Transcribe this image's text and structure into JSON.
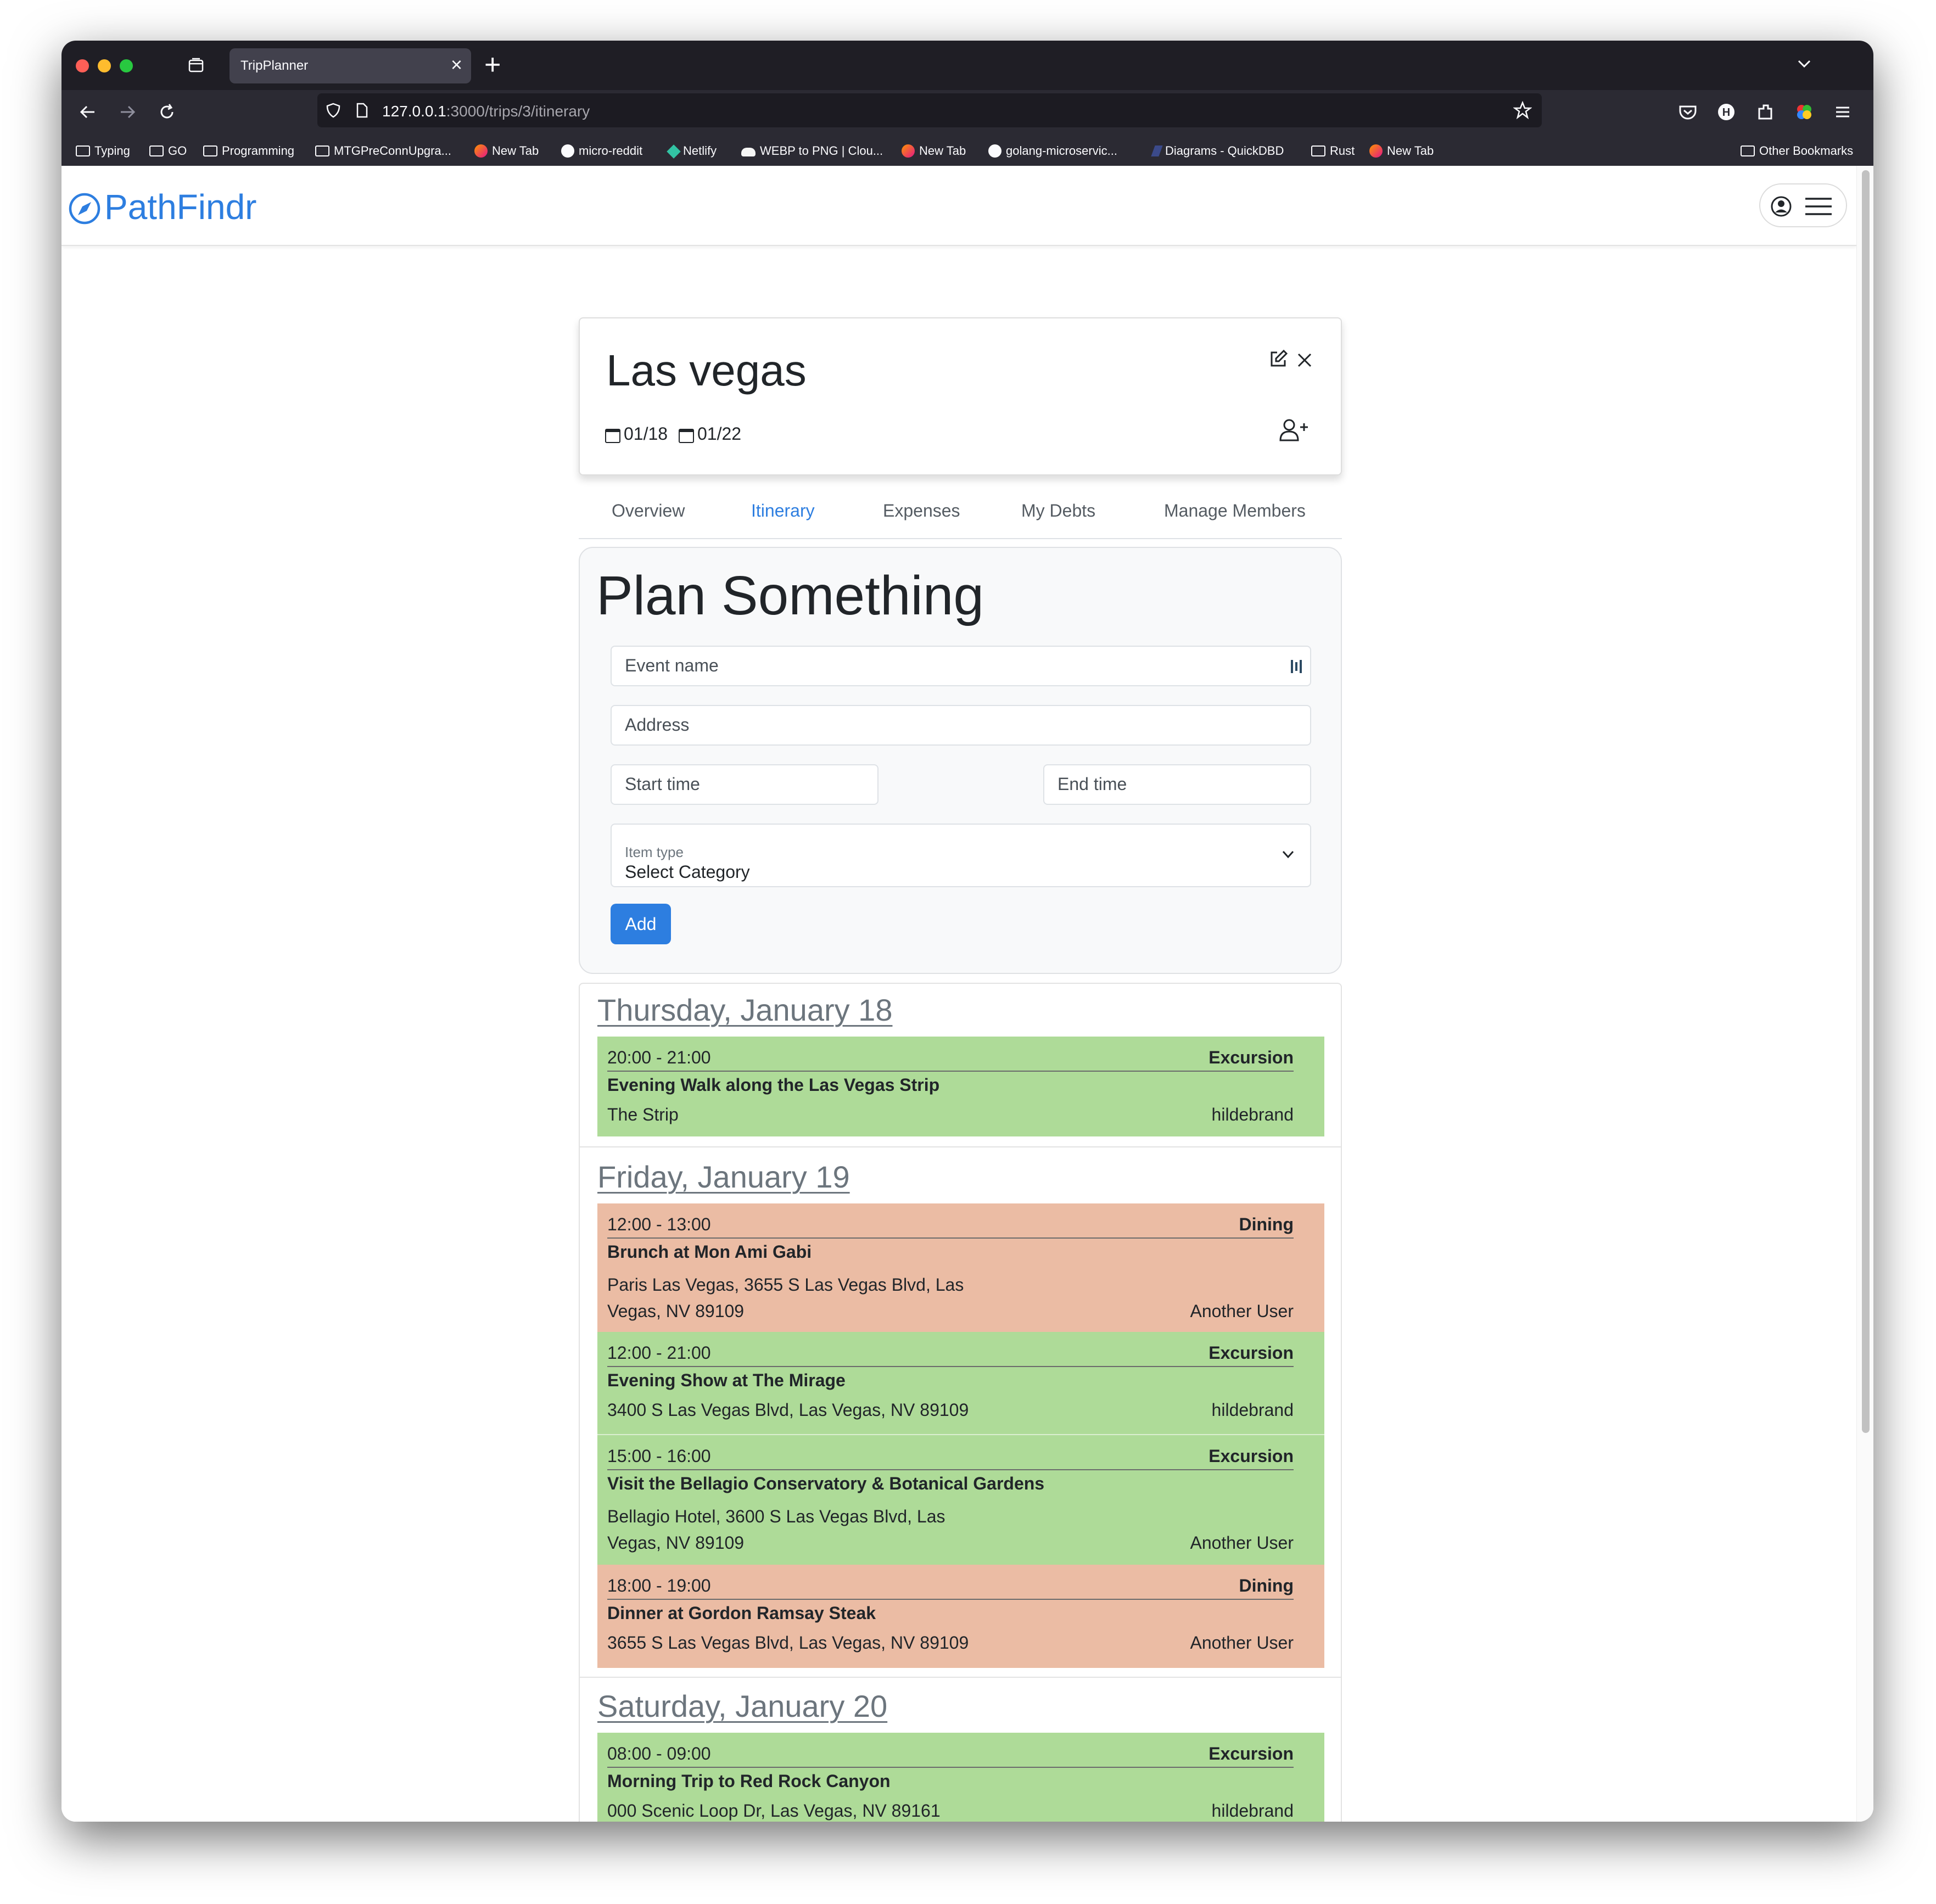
{
  "browser": {
    "tab_title": "TripPlanner",
    "url_host": "127.0.0.1",
    "url_path": ":3000/trips/3/itinerary",
    "bookmarks": [
      {
        "label": "Typing",
        "icon": "folder-icon"
      },
      {
        "label": "GO",
        "icon": "folder-icon"
      },
      {
        "label": "Programming",
        "icon": "folder-icon"
      },
      {
        "label": "MTGPreConnUpgra...",
        "icon": "folder-icon"
      },
      {
        "label": "New Tab",
        "icon": "firefox-icon"
      },
      {
        "label": "micro-reddit",
        "icon": "github-icon"
      },
      {
        "label": "Netlify",
        "icon": "netlify-icon"
      },
      {
        "label": "WEBP to PNG | Clou...",
        "icon": "cloud-icon"
      },
      {
        "label": "New Tab",
        "icon": "firefox-icon"
      },
      {
        "label": "golang-microservic...",
        "icon": "github-icon"
      },
      {
        "label": "Diagrams - QuickDBD",
        "icon": "quickdbd-icon"
      },
      {
        "label": "Rust",
        "icon": "folder-icon"
      },
      {
        "label": "New Tab",
        "icon": "firefox-icon"
      }
    ],
    "other_bookmarks": "Other Bookmarks"
  },
  "app": {
    "brand": "PathFindr",
    "accent": "#2d7ee0"
  },
  "trip": {
    "title": "Las vegas",
    "start": "01/18",
    "end": "01/22"
  },
  "tabs": [
    "Overview",
    "Itinerary",
    "Expenses",
    "My Debts",
    "Manage Members"
  ],
  "active_tab": "Itinerary",
  "plan": {
    "heading": "Plan Something",
    "event_name_placeholder": "Event name",
    "address_placeholder": "Address",
    "start_placeholder": "Start time",
    "end_placeholder": "End time",
    "item_type_label": "Item type",
    "item_type_value": "Select Category",
    "add_label": "Add"
  },
  "days": [
    {
      "heading": "Thursday, January 18",
      "events": [
        {
          "time": "20:00 - 21:00",
          "type": "Excursion",
          "name": "Evening Walk along the Las Vegas Strip",
          "address": "The Strip",
          "user": "hildebrand",
          "color": "#aedb98"
        }
      ]
    },
    {
      "heading": "Friday, January 19",
      "events": [
        {
          "time": "12:00 - 13:00",
          "type": "Dining",
          "name": "Brunch at Mon Ami Gabi",
          "address_line1": "Paris Las Vegas, 3655 S Las Vegas Blvd, Las",
          "address_line2": "Vegas, NV 89109",
          "user": "Another User",
          "color": "#ebbca4"
        },
        {
          "time": "12:00 - 21:00",
          "type": "Excursion",
          "name": "Evening Show at The Mirage",
          "address": "3400 S Las Vegas Blvd, Las Vegas, NV 89109",
          "user": "hildebrand",
          "color": "#aedb98"
        },
        {
          "time": "15:00 - 16:00",
          "type": "Excursion",
          "name": "Visit the Bellagio Conservatory & Botanical Gardens",
          "address_line1": "Bellagio Hotel, 3600 S Las Vegas Blvd, Las",
          "address_line2": "Vegas, NV 89109",
          "user": "Another User",
          "color": "#aedb98"
        },
        {
          "time": "18:00 - 19:00",
          "type": "Dining",
          "name": "Dinner at Gordon Ramsay Steak",
          "address": "3655 S Las Vegas Blvd, Las Vegas, NV 89109",
          "user": "Another User",
          "color": "#ebbca4"
        }
      ]
    },
    {
      "heading": "Saturday, January 20",
      "events": [
        {
          "time": "08:00 - 09:00",
          "type": "Excursion",
          "name": "Morning Trip to Red Rock Canyon",
          "address": "000 Scenic Loop Dr, Las Vegas, NV 89161",
          "user": "hildebrand",
          "color": "#aedb98"
        }
      ]
    }
  ]
}
